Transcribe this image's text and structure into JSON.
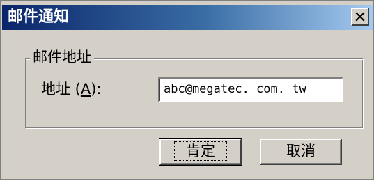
{
  "dialog": {
    "title": "邮件通知",
    "close_icon": "close-icon"
  },
  "group": {
    "legend": "邮件地址"
  },
  "field": {
    "label": "地址 (",
    "label_accel": "A",
    "label_suffix": "):",
    "value": "abc@megatec. com. tw"
  },
  "buttons": {
    "ok_label": "肯定",
    "cancel_label": "取消"
  },
  "colors": {
    "title_bar_start": "#0a246a",
    "title_bar_end": "#a6caf0",
    "face": "#d4d0c8"
  }
}
